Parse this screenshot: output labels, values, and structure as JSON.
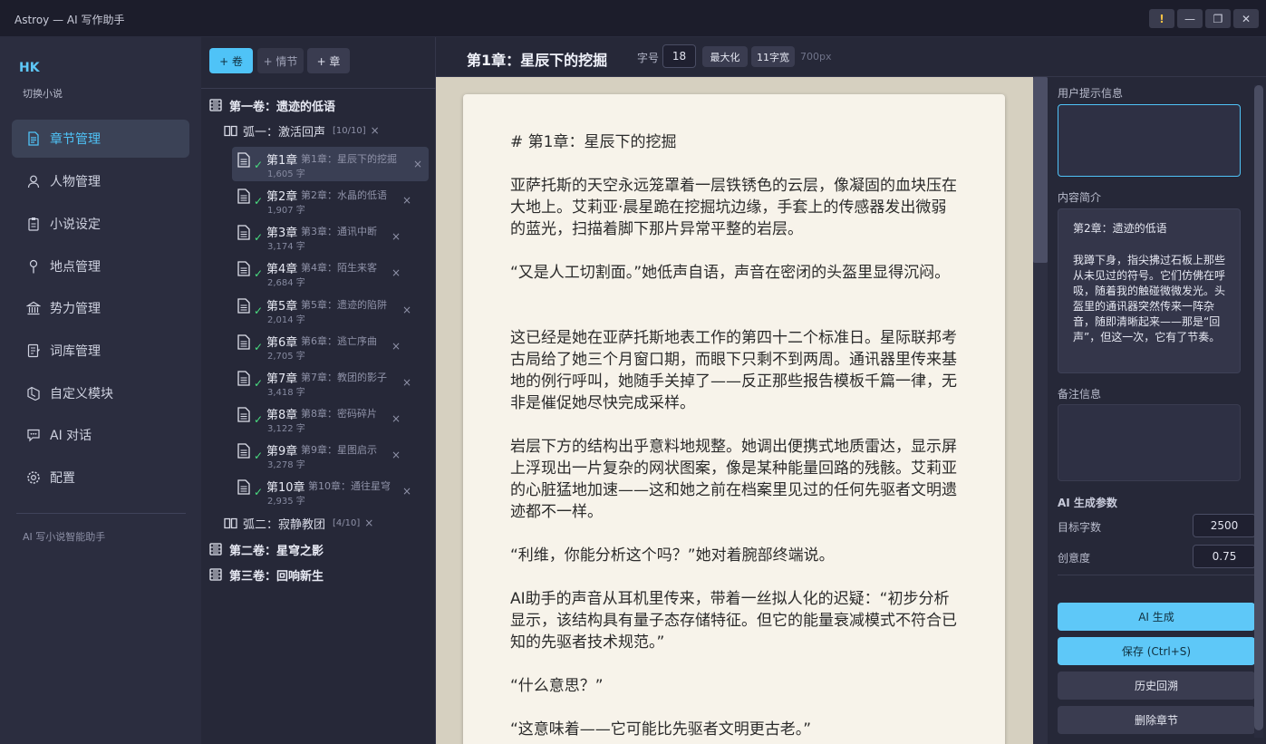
{
  "window": {
    "title": "Astroy — AI 写作助手",
    "buttons": [
      "!",
      "—",
      "❐",
      "✕"
    ]
  },
  "nav": {
    "brand": "HK",
    "switch_novel": "切换小说",
    "items": [
      {
        "label": "章节管理",
        "icon": "document-icon",
        "active": true
      },
      {
        "label": "人物管理",
        "icon": "person-icon",
        "active": false
      },
      {
        "label": "小说设定",
        "icon": "clipboard-icon",
        "active": false
      },
      {
        "label": "地点管理",
        "icon": "pin-icon",
        "active": false
      },
      {
        "label": "势力管理",
        "icon": "bank-icon",
        "active": false
      },
      {
        "label": "词库管理",
        "icon": "notebook-icon",
        "active": false
      },
      {
        "label": "自定义模块",
        "icon": "puzzle-icon",
        "active": false
      },
      {
        "label": "AI 对话",
        "icon": "chat-icon",
        "active": false
      },
      {
        "label": "配置",
        "icon": "gear-icon",
        "active": false
      }
    ],
    "footer": "AI 写小说智能助手"
  },
  "tree": {
    "toolbar": {
      "add_volume": "+ 卷",
      "add_plot": "+ 情节",
      "add_chapter": "+ 章"
    },
    "volumes": [
      {
        "label": "第一卷：遗迹的低语"
      },
      {
        "label": "第二卷：星穹之影"
      },
      {
        "label": "第三卷：回响新生"
      }
    ],
    "arcs": [
      {
        "label": "弧一：激活回声",
        "count": "[10/10]",
        "close": "×"
      },
      {
        "label": "弧二：寂静教团",
        "count": "[4/10]",
        "close": "×"
      }
    ],
    "chapters": [
      {
        "name": "第1章",
        "subtitle": "第1章：星辰下的挖掘",
        "words": "1,605 字",
        "active": true
      },
      {
        "name": "第2章",
        "subtitle": "第2章：水晶的低语",
        "words": "1,907 字",
        "active": false
      },
      {
        "name": "第3章",
        "subtitle": "第3章：通讯中断",
        "words": "3,174 字",
        "active": false
      },
      {
        "name": "第4章",
        "subtitle": "第4章：陌生来客",
        "words": "2,684 字",
        "active": false
      },
      {
        "name": "第5章",
        "subtitle": "第5章：遗迹的陷阱",
        "words": "2,014 字",
        "active": false
      },
      {
        "name": "第6章",
        "subtitle": "第6章：逃亡序曲",
        "words": "2,705 字",
        "active": false
      },
      {
        "name": "第7章",
        "subtitle": "第7章：教团的影子",
        "words": "3,418 字",
        "active": false
      },
      {
        "name": "第8章",
        "subtitle": "第8章：密码碎片",
        "words": "3,122 字",
        "active": false
      },
      {
        "name": "第9章",
        "subtitle": "第9章：星图启示",
        "words": "3,278 字",
        "active": false
      },
      {
        "name": "第10章",
        "subtitle": "第10章：通往星穹",
        "words": "2,935 字",
        "active": false
      }
    ],
    "check": "✓",
    "close": "×"
  },
  "editor": {
    "title": "第1章：星辰下的挖掘",
    "font_size_label": "字号",
    "font_size": "18",
    "maximize": "最大化",
    "width_label": "11字宽",
    "width_px": "700px",
    "paragraphs": [
      "# 第1章：星辰下的挖掘",
      "亚萨托斯的天空永远笼罩着一层铁锈色的云层，像凝固的血块压在大地上。艾莉亚·晨星跪在挖掘坑边缘，手套上的传感器发出微弱的蓝光，扫描着脚下那片异常平整的岩层。",
      "“又是人工切割面。”她低声自语，声音在密闭的头盔里显得沉闷。",
      "这已经是她在亚萨托斯地表工作的第四十二个标准日。星际联邦考古局给了她三个月窗口期，而眼下只剩不到两周。通讯器里传来基地的例行呼叫，她随手关掉了——反正那些报告模板千篇一律，无非是催促她尽快完成采样。",
      "岩层下方的结构出乎意料地规整。她调出便携式地质雷达，显示屏上浮现出一片复杂的网状图案，像是某种能量回路的残骸。艾莉亚的心脏猛地加速——这和她之前在档案里见过的任何先驱者文明遗迹都不一样。",
      "“利维，你能分析这个吗？”她对着腕部终端说。",
      "AI助手的声音从耳机里传来，带着一丝拟人化的迟疑：“初步分析显示，该结构具有量子态存储特征。但它的能量衰减模式不符合已知的先驱者技术规范。”",
      "“什么意思？”",
      "“这意味着——它可能比先驱者文明更古老。”"
    ]
  },
  "right": {
    "hint_label": "用户提示信息",
    "summary_label": "内容简介",
    "summary_title": "第2章：遗迹的低语",
    "summary_body": "我蹲下身，指尖拂过石板上那些从未见过的符号。它们仿佛在呼吸，随着我的触碰微微发光。头盔里的通讯器突然传来一阵杂音，随即清晰起来——那是“回声”，但这一次，它有了节奏。",
    "notes_label": "备注信息",
    "params_label": "AI 生成参数",
    "target_words_label": "目标字数",
    "target_words": "2500",
    "creativity_label": "创意度",
    "creativity": "0.75",
    "btn_generate": "AI 生成",
    "btn_save": "保存 (Ctrl+S)",
    "btn_history": "历史回溯",
    "btn_delete": "删除章节"
  },
  "colors": {
    "accent": "#4fc3f7",
    "check": "#4ade80",
    "paper": "#f7f3ea"
  }
}
